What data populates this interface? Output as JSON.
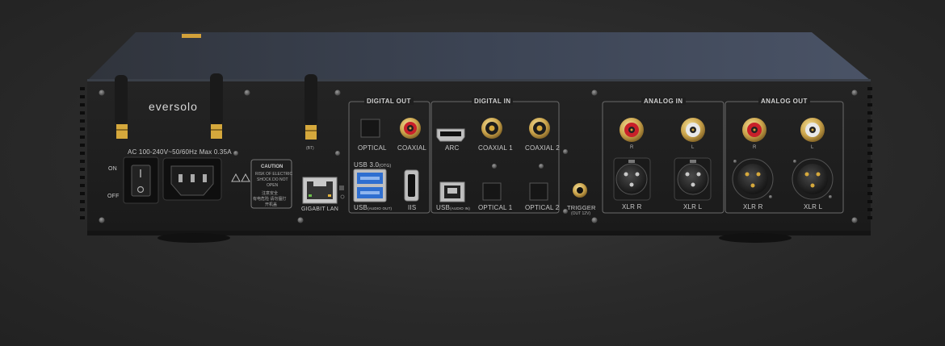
{
  "brand": {
    "logo": "eversolo"
  },
  "power": {
    "spec": "AC 100-240V~50/60Hz Max 0.35A",
    "on": "ON",
    "off": "OFF"
  },
  "caution": {
    "title": "CAUTION",
    "line1": "RISK OF ELECTRIC",
    "line2": "SHOCK DO NOT",
    "line3": "OPEN",
    "zh1": "注意安全",
    "zh2": "有电危险 请勿擅打",
    "zh3": "开机盖"
  },
  "antenna": {
    "bt": "(BT)"
  },
  "ports": {
    "lan": "GIGABIT LAN",
    "usb3": "USB 3.0",
    "usb3_sub": "(OTG)",
    "usb_out": "USB",
    "usb_out_sub": "(AUDIO OUT)",
    "iis": "IIS",
    "usb_in": "USB",
    "usb_in_sub": "(AUDIO IN)",
    "trigger": "TRIGGER",
    "trigger_sub": "(OUT 12V)"
  },
  "digital_out": {
    "header": "DIGITAL OUT",
    "optical": "OPTICAL",
    "coaxial": "COAXIAL"
  },
  "digital_in": {
    "header": "DIGITAL IN",
    "arc": "ARC",
    "coaxial1": "COAXIAL 1",
    "coaxial2": "COAXIAL 2",
    "optical1": "OPTICAL 1",
    "optical2": "OPTICAL 2"
  },
  "analog_in": {
    "header": "ANALOG IN",
    "r": "R",
    "l": "L",
    "xlr_r": "XLR R",
    "xlr_l": "XLR L"
  },
  "analog_out": {
    "header": "ANALOG OUT",
    "r": "R",
    "l": "L",
    "xlr_r": "XLR R",
    "xlr_l": "XLR L"
  }
}
